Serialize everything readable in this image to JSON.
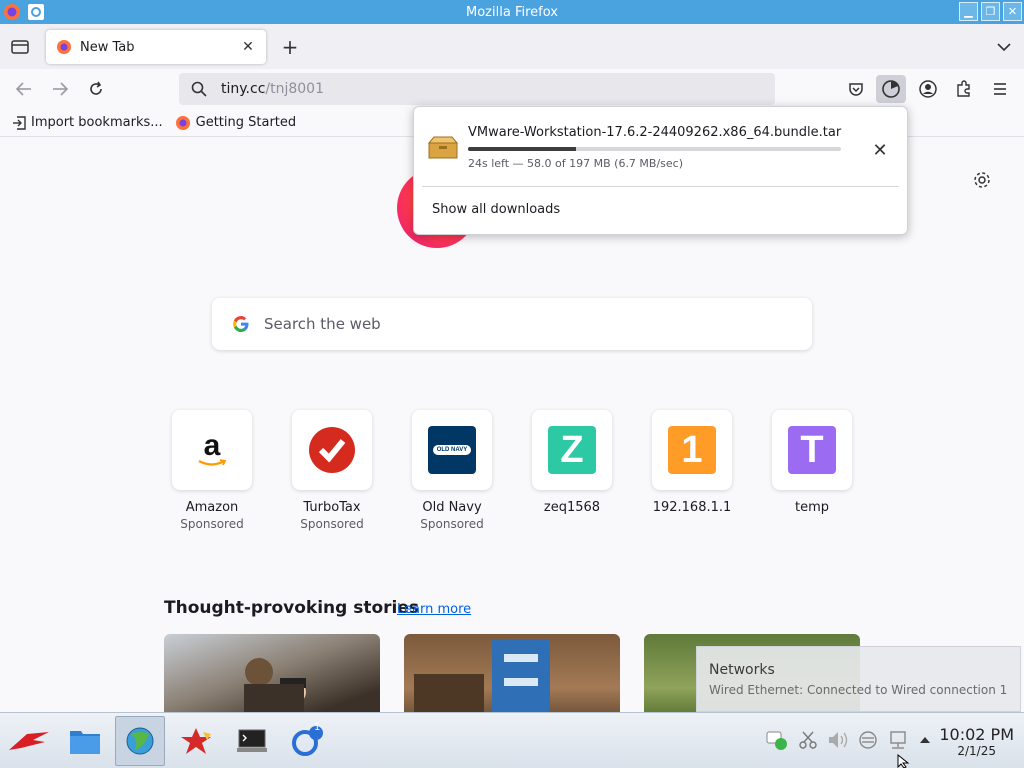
{
  "window": {
    "title": "Mozilla Firefox"
  },
  "tabs": [
    {
      "label": "New Tab"
    }
  ],
  "navbar": {
    "url_host": "tiny.cc",
    "url_path": "/tnj8001"
  },
  "bookmarks": [
    {
      "label": "Import bookmarks..."
    },
    {
      "label": "Getting Started"
    }
  ],
  "download": {
    "filename": "VMware-Workstation-17.6.2-24409262.x86_64.bundle.tar",
    "status": "24s left — 58.0 of 197 MB (6.7 MB/sec)",
    "progress": 0.29,
    "show_all_label": "Show all downloads"
  },
  "search": {
    "placeholder": "Search the web"
  },
  "top_sites": [
    {
      "title": "Amazon",
      "sub": "Sponsored",
      "icon": "amazon-logo",
      "color": "#ffffff"
    },
    {
      "title": "TurboTax",
      "sub": "Sponsored",
      "icon": "turbotax-check",
      "color": "#d52b1e"
    },
    {
      "title": "Old Navy",
      "sub": "Sponsored",
      "icon": "oldnavy-logo",
      "color": "#003764"
    },
    {
      "title": "zeq1568",
      "sub": "",
      "icon": "letter-z",
      "color": "#2dc9a4"
    },
    {
      "title": "192.168.1.1",
      "sub": "",
      "icon": "digit-1",
      "color": "#ff9c28"
    },
    {
      "title": "temp",
      "sub": "",
      "icon": "letter-t",
      "color": "#9b6bf2"
    }
  ],
  "top_site_letters": {
    "amazon": "a",
    "oldnavy": "OLD NAVY",
    "zeq": "Z",
    "ip": "1",
    "temp": "T"
  },
  "stories": {
    "title": "Thought-provoking stories",
    "learn_more": "Learn more"
  },
  "notification": {
    "title": "Networks",
    "body": "Wired Ethernet: Connected to Wired connection 1"
  },
  "taskbar": {
    "time": "10:02 PM",
    "date": "2/1/25",
    "badge": "1"
  }
}
